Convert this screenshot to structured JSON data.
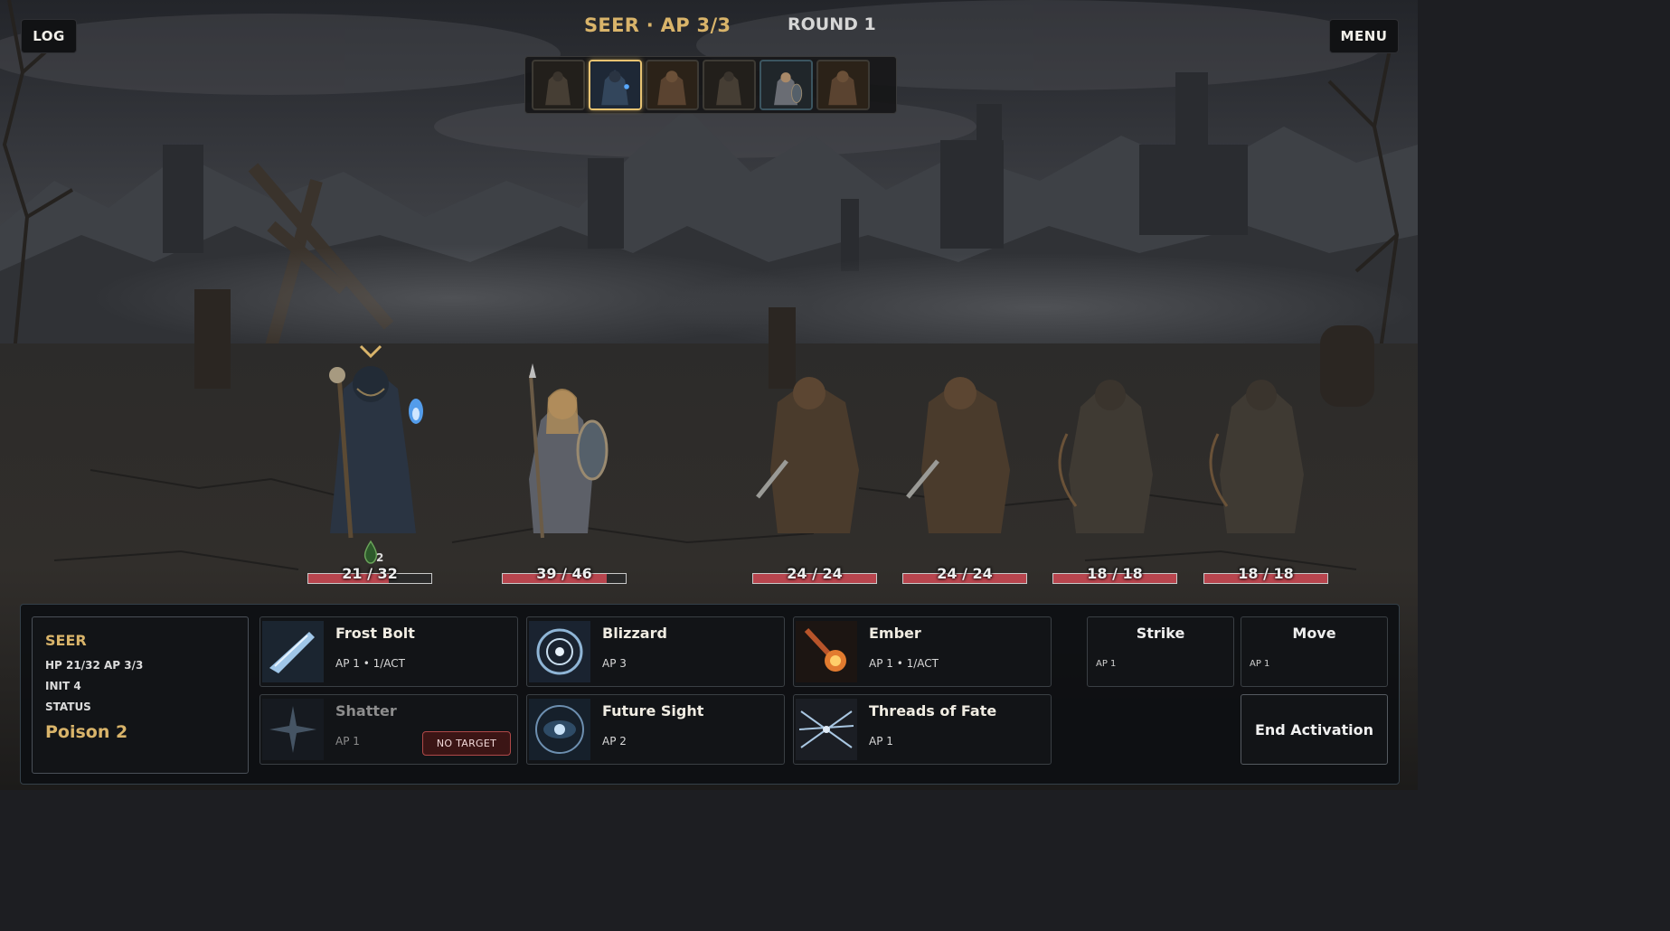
{
  "top": {
    "log_label": "LOG",
    "menu_label": "MENU",
    "turn_title": "SEER · AP 3/3",
    "round_label": "ROUND 1"
  },
  "turn_order": [
    {
      "icon": "rogue-portrait",
      "active": false,
      "side": "enemy"
    },
    {
      "icon": "seer-portrait",
      "active": true,
      "side": "ally"
    },
    {
      "icon": "brute-portrait",
      "active": false,
      "side": "enemy"
    },
    {
      "icon": "rogue-portrait",
      "active": false,
      "side": "enemy"
    },
    {
      "icon": "shieldmaiden-portrait",
      "active": false,
      "side": "ally"
    },
    {
      "icon": "brute-portrait",
      "active": false,
      "side": "enemy"
    }
  ],
  "units": [
    {
      "hp_text": "21 / 32",
      "hp_fraction": 0.656
    },
    {
      "hp_text": "39 / 46",
      "hp_fraction": 0.848
    },
    {
      "hp_text": "24 / 24",
      "hp_fraction": 1.0
    },
    {
      "hp_text": "24 / 24",
      "hp_fraction": 1.0
    },
    {
      "hp_text": "18 / 18",
      "hp_fraction": 1.0
    },
    {
      "hp_text": "18 / 18",
      "hp_fraction": 1.0
    }
  ],
  "active_unit": {
    "poison_stack": "2",
    "name": "SEER",
    "hp_ap": "HP 21/32    AP 3/3",
    "init": "INIT 4",
    "status_label": "STATUS",
    "status_value": "Poison 2"
  },
  "abilities": [
    {
      "name": "Frost Bolt",
      "cost": "AP 1 • 1/ACT",
      "icon": "frost-bolt-icon",
      "disabled": false
    },
    {
      "name": "Blizzard",
      "cost": "AP 3",
      "icon": "blizzard-icon",
      "disabled": false
    },
    {
      "name": "Ember",
      "cost": "AP 1 • 1/ACT",
      "icon": "ember-icon",
      "disabled": false
    },
    {
      "name": "Shatter",
      "cost": "AP 1",
      "icon": "shatter-icon",
      "disabled": true,
      "badge": "NO TARGET"
    },
    {
      "name": "Future Sight",
      "cost": "AP 2",
      "icon": "future-sight-icon",
      "disabled": false
    },
    {
      "name": "Threads of Fate",
      "cost": "AP 1",
      "icon": "threads-of-fate-icon",
      "disabled": false
    }
  ],
  "basic_actions": [
    {
      "name": "Strike",
      "cost": "AP 1"
    },
    {
      "name": "Move",
      "cost": "AP 1"
    }
  ],
  "end_label": "End Activation",
  "colors": {
    "accent": "#d9b46a",
    "hp": "#b8454e",
    "panel": "#121417"
  }
}
